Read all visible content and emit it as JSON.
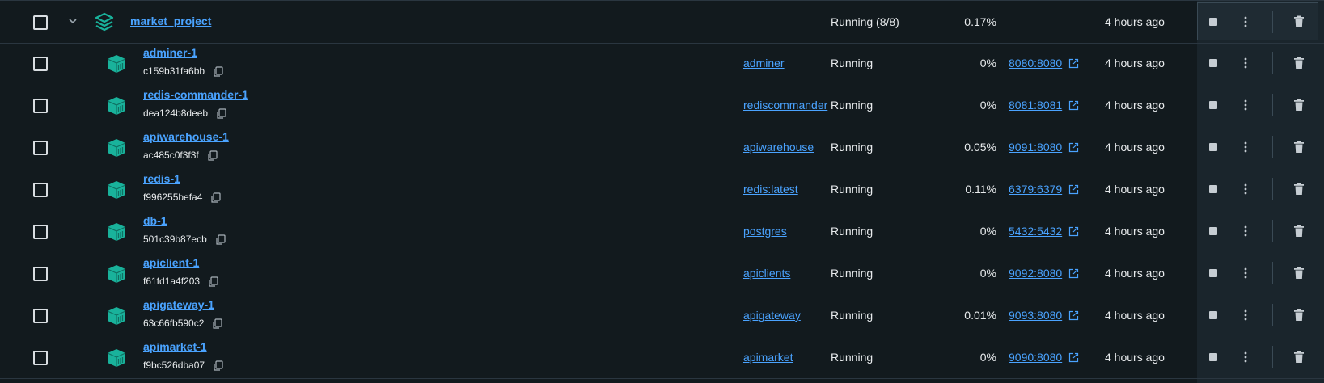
{
  "project": {
    "name": "market_project",
    "status": "Running (8/8)",
    "cpu": "0.17%",
    "started": "4 hours ago",
    "icon": "stack-icon"
  },
  "containers": [
    {
      "name": "adminer-1",
      "id": "c159b31fa6bb",
      "image": "adminer",
      "status": "Running",
      "cpu": "0%",
      "port": "8080:8080",
      "started": "4 hours ago"
    },
    {
      "name": "redis-commander-1",
      "id": "dea124b8deeb",
      "image": "rediscommander",
      "status": "Running",
      "cpu": "0%",
      "port": "8081:8081",
      "started": "4 hours ago"
    },
    {
      "name": "apiwarehouse-1",
      "id": "ac485c0f3f3f",
      "image": "apiwarehouse",
      "status": "Running",
      "cpu": "0.05%",
      "port": "9091:8080",
      "started": "4 hours ago"
    },
    {
      "name": "redis-1",
      "id": "f996255befa4",
      "image": "redis:latest",
      "status": "Running",
      "cpu": "0.11%",
      "port": "6379:6379",
      "started": "4 hours ago"
    },
    {
      "name": "db-1",
      "id": "501c39b87ecb",
      "image": "postgres",
      "status": "Running",
      "cpu": "0%",
      "port": "5432:5432",
      "started": "4 hours ago"
    },
    {
      "name": "apiclient-1",
      "id": "f61fd1a4f203",
      "image": "apiclients",
      "status": "Running",
      "cpu": "0%",
      "port": "9092:8080",
      "started": "4 hours ago"
    },
    {
      "name": "apigateway-1",
      "id": "63c66fb590c2",
      "image": "apigateway",
      "status": "Running",
      "cpu": "0.01%",
      "port": "9093:8080",
      "started": "4 hours ago"
    },
    {
      "name": "apimarket-1",
      "id": "f9bc526dba07",
      "image": "apimarket",
      "status": "Running",
      "cpu": "0%",
      "port": "9090:8080",
      "started": "4 hours ago"
    }
  ],
  "icons": {
    "container": "container-icon",
    "copy": "copy-icon",
    "external_link": "external-link-icon",
    "stop": "stop-icon",
    "more": "kebab-menu-icon",
    "delete": "trash-icon",
    "expand": "chevron-down-icon"
  },
  "colors": {
    "background": "#121a1e",
    "link": "#4aa3ff",
    "icon_teal": "#19b29b",
    "text": "#e8ebed"
  }
}
